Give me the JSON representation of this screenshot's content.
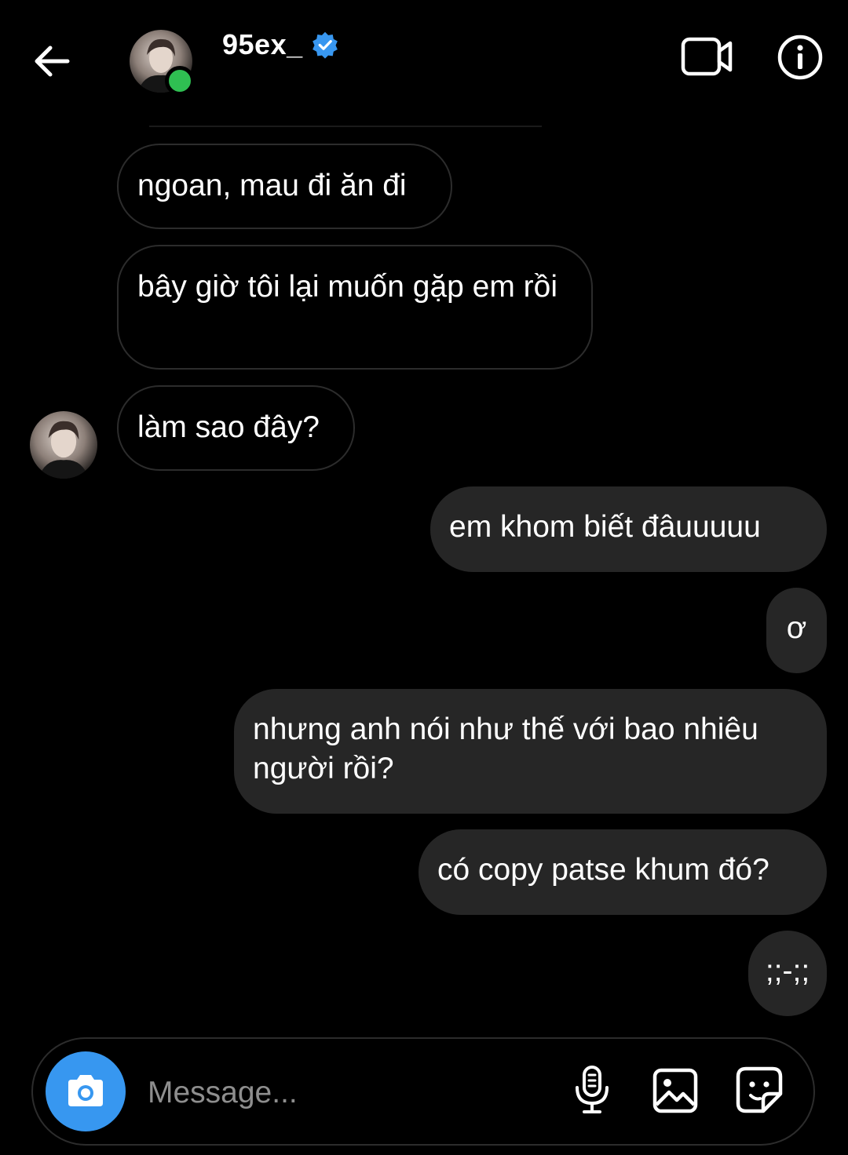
{
  "header": {
    "username": "95ex_",
    "verified": true,
    "online": true,
    "icons": {
      "back": "arrow-left-icon",
      "video": "video-camera-icon",
      "info": "info-icon"
    }
  },
  "messages": [
    {
      "direction": "incoming",
      "text": "ngoan, mau đi ăn đi"
    },
    {
      "direction": "incoming",
      "text": "bây giờ tôi lại muốn gặp em rồi"
    },
    {
      "direction": "incoming",
      "text": "làm sao đây?"
    },
    {
      "direction": "outgoing",
      "text": "em khom biết đâuuuuu"
    },
    {
      "direction": "outgoing",
      "text": "ơ"
    },
    {
      "direction": "outgoing",
      "text": "nhưng anh nói như thế với bao nhiêu người rồi?"
    },
    {
      "direction": "outgoing",
      "text": "có copy patse khum đó?"
    },
    {
      "direction": "outgoing",
      "text": ";;-;;"
    }
  ],
  "composer": {
    "placeholder": "Message...",
    "icons": {
      "camera": "camera-icon",
      "mic": "microphone-icon",
      "gallery": "image-icon",
      "sticker": "sticker-icon"
    }
  },
  "colors": {
    "background": "#000000",
    "outgoing_bubble": "#262626",
    "incoming_border": "#2c2c2c",
    "accent": "#3797f0",
    "online": "#2fbf52",
    "verified": "#3897f0"
  }
}
